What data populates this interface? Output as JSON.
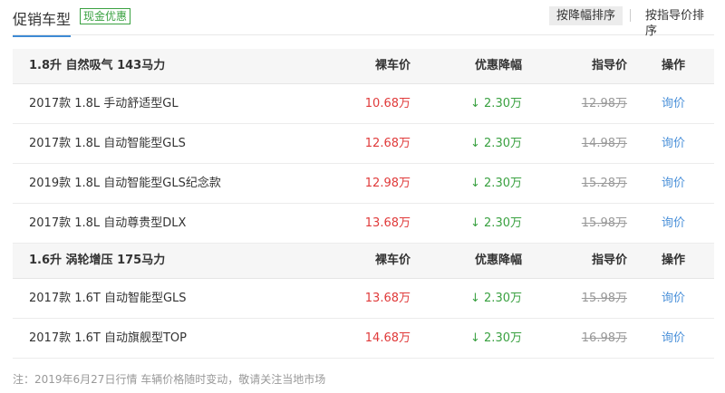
{
  "header": {
    "title": "促销车型",
    "badge": "现金优惠",
    "sort_discount": "按降幅排序",
    "sort_guide": "按指导价排序"
  },
  "columns": {
    "price": "裸车价",
    "discount": "优惠降幅",
    "guide": "指导价",
    "action": "操作"
  },
  "groups": [
    {
      "title": "1.8升 自然吸气 143马力",
      "rows": [
        {
          "name": "2017款 1.8L 手动舒适型GL",
          "price": "10.68万",
          "discount": "↓ 2.30万",
          "guide": "12.98万",
          "action": "询价"
        },
        {
          "name": "2017款 1.8L 自动智能型GLS",
          "price": "12.68万",
          "discount": "↓ 2.30万",
          "guide": "14.98万",
          "action": "询价"
        },
        {
          "name": "2019款 1.8L 自动智能型GLS纪念款",
          "price": "12.98万",
          "discount": "↓ 2.30万",
          "guide": "15.28万",
          "action": "询价"
        },
        {
          "name": "2017款 1.8L 自动尊贵型DLX",
          "price": "13.68万",
          "discount": "↓ 2.30万",
          "guide": "15.98万",
          "action": "询价"
        }
      ]
    },
    {
      "title": "1.6升 涡轮增压 175马力",
      "rows": [
        {
          "name": "2017款 1.6T 自动智能型GLS",
          "price": "13.68万",
          "discount": "↓ 2.30万",
          "guide": "15.98万",
          "action": "询价"
        },
        {
          "name": "2017款 1.6T 自动旗舰型TOP",
          "price": "14.68万",
          "discount": "↓ 2.30万",
          "guide": "16.98万",
          "action": "询价"
        }
      ]
    }
  ],
  "note": "注：2019年6月27日行情 车辆价格随时变动，敬请关注当地市场"
}
